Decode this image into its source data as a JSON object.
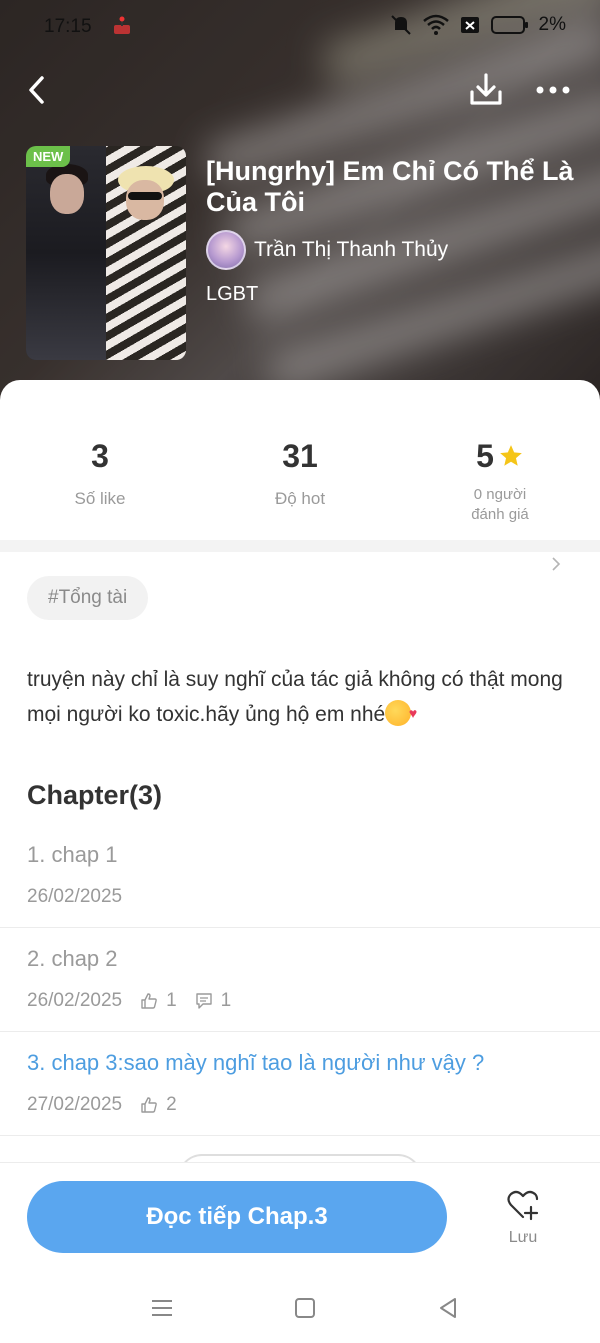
{
  "status_bar": {
    "time": "17:15",
    "battery_percent": "2%",
    "icons": [
      "game-controller-icon",
      "mute-icon",
      "wifi-icon",
      "no-sim-icon",
      "battery-icon"
    ]
  },
  "header": {
    "badge": "NEW",
    "title": "[Hungrhy] Em Chỉ Có Thể Là Của Tôi",
    "author": "Trần Thị Thanh Thủy",
    "genre": "LGBT"
  },
  "stats": {
    "likes_value": "3",
    "likes_label": "Số like",
    "hot_value": "31",
    "hot_label": "Độ hot",
    "rating_value": "5",
    "rating_label": "0 người\nđánh giá"
  },
  "tag": "#Tổng tài",
  "description": "truyện này chỉ là suy nghĩ của tác giả không có thật mong mọi người ko toxic.hãy ủng hộ em nhé",
  "chapter_heading": "Chapter(3)",
  "chapters": [
    {
      "name": "1. chap 1",
      "date": "26/02/2025",
      "likes": "",
      "comments": ""
    },
    {
      "name": "2. chap 2",
      "date": "26/02/2025",
      "likes": "1",
      "comments": "1"
    },
    {
      "name": "3. chap 3:sao mày nghĩ tao là người như vậy ?",
      "date": "27/02/2025",
      "likes": "2",
      "comments": ""
    }
  ],
  "bottom": {
    "read_label": "Đọc tiếp Chap.3",
    "save_label": "Lưu"
  },
  "colors": {
    "accent": "#5aa6ef",
    "current_chapter": "#4d9de0",
    "new_badge": "#6cc04a",
    "star": "#f5c518"
  }
}
